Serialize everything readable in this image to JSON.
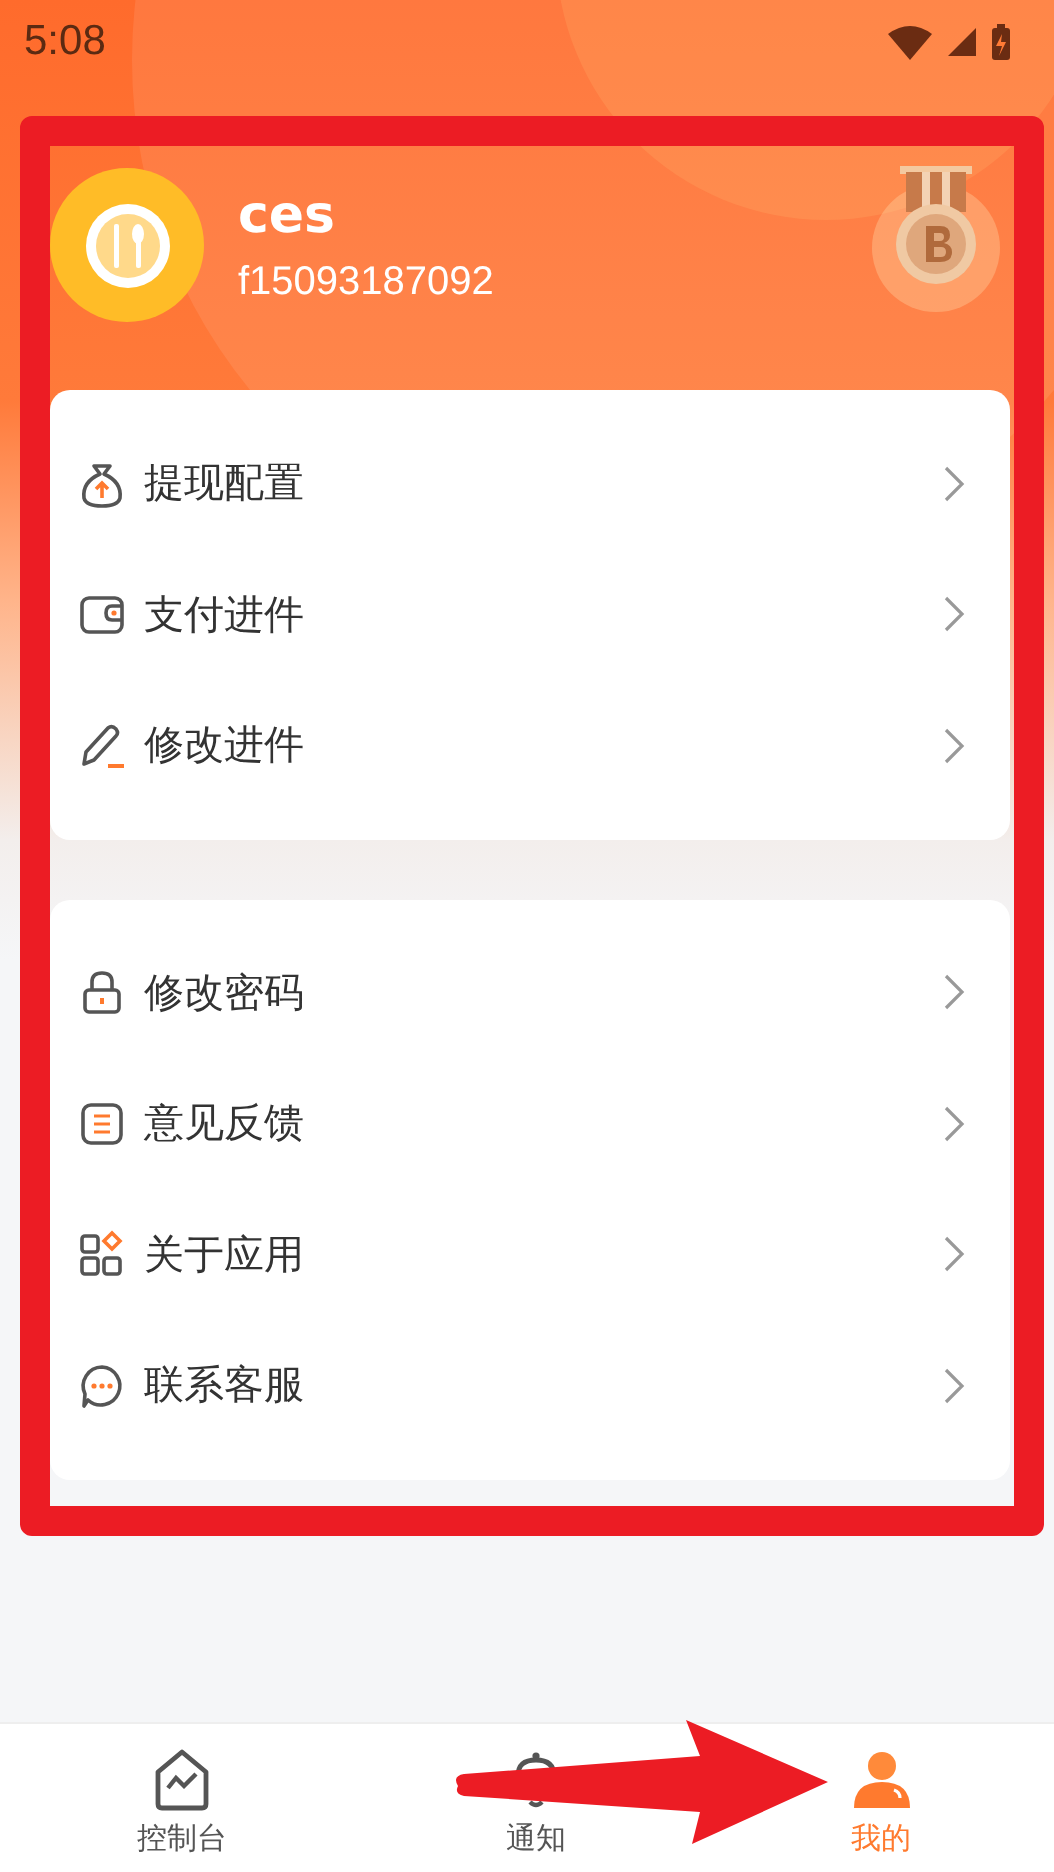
{
  "status_bar": {
    "time": "5:08"
  },
  "profile": {
    "name": "ces",
    "account": "f15093187092"
  },
  "menu_groups": [
    {
      "items": [
        {
          "label": "提现配置"
        },
        {
          "label": "支付进件"
        },
        {
          "label": "修改进件"
        }
      ]
    },
    {
      "items": [
        {
          "label": "修改密码"
        },
        {
          "label": "意见反馈"
        },
        {
          "label": "关于应用"
        },
        {
          "label": "联系客服"
        }
      ]
    }
  ],
  "tabs": [
    {
      "label": "控制台",
      "selected": false
    },
    {
      "label": "通知",
      "selected": false
    },
    {
      "label": "我的",
      "selected": true
    }
  ]
}
